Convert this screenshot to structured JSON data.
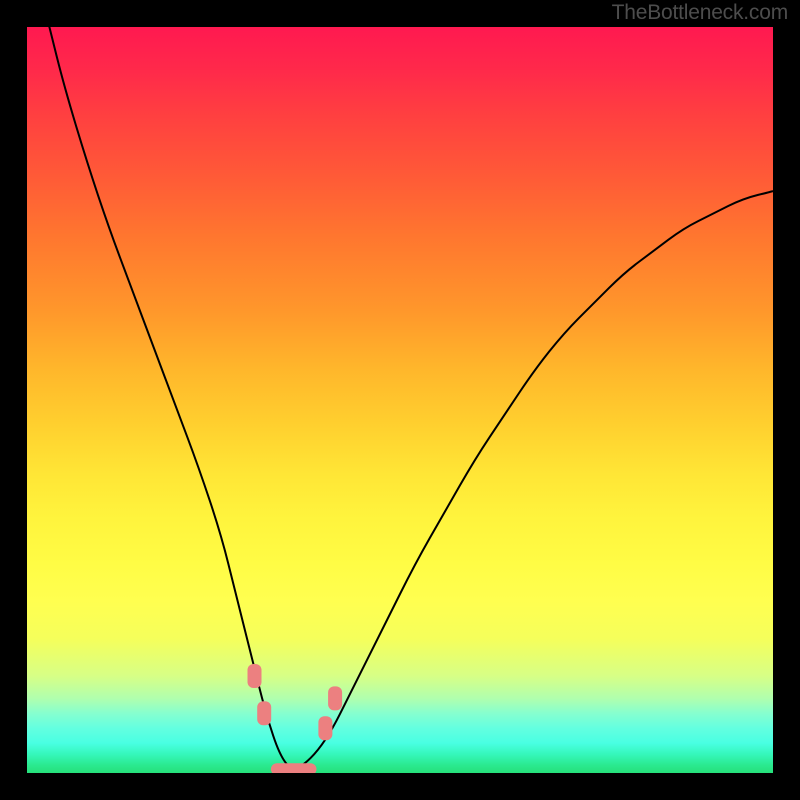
{
  "watermark": "TheBottleneck.com",
  "chart_data": {
    "type": "line",
    "title": "",
    "xlabel": "",
    "ylabel": "",
    "xlim": [
      0,
      100
    ],
    "ylim": [
      0,
      100
    ],
    "grid": false,
    "legend": false,
    "background_gradient": {
      "top": "#ff1950",
      "middle": "#ffff50",
      "bottom": "#26e07a",
      "note": "vertical gradient red→orange→yellow→green encoding bottleneck severity; green band is very thin near y≈0"
    },
    "series": [
      {
        "name": "bottleneck-curve",
        "color": "#000000",
        "x": [
          3,
          5,
          8,
          11,
          14,
          17,
          20,
          23,
          26,
          28,
          30,
          32,
          34,
          36,
          40,
          44,
          48,
          52,
          56,
          60,
          64,
          68,
          72,
          76,
          80,
          84,
          88,
          92,
          96,
          100
        ],
        "y": [
          100,
          92,
          82,
          73,
          65,
          57,
          49,
          41,
          32,
          24,
          16,
          8,
          2,
          0,
          4,
          12,
          20,
          28,
          35,
          42,
          48,
          54,
          59,
          63,
          67,
          70,
          73,
          75,
          77,
          78
        ]
      }
    ],
    "annotations": [
      {
        "type": "marker",
        "shape": "rounded-rect",
        "color": "#ec8080",
        "note": "highlighted points near valley where curve enters green band",
        "points": [
          {
            "x": 30.5,
            "y": 13
          },
          {
            "x": 31.8,
            "y": 8
          },
          {
            "x": 40.0,
            "y": 6
          },
          {
            "x": 41.3,
            "y": 10
          }
        ]
      },
      {
        "type": "segment",
        "shape": "thick-line",
        "color": "#ec8080",
        "note": "valley floor highlight",
        "from": {
          "x": 33.5,
          "y": 0.5
        },
        "to": {
          "x": 38.0,
          "y": 0.5
        }
      }
    ]
  }
}
